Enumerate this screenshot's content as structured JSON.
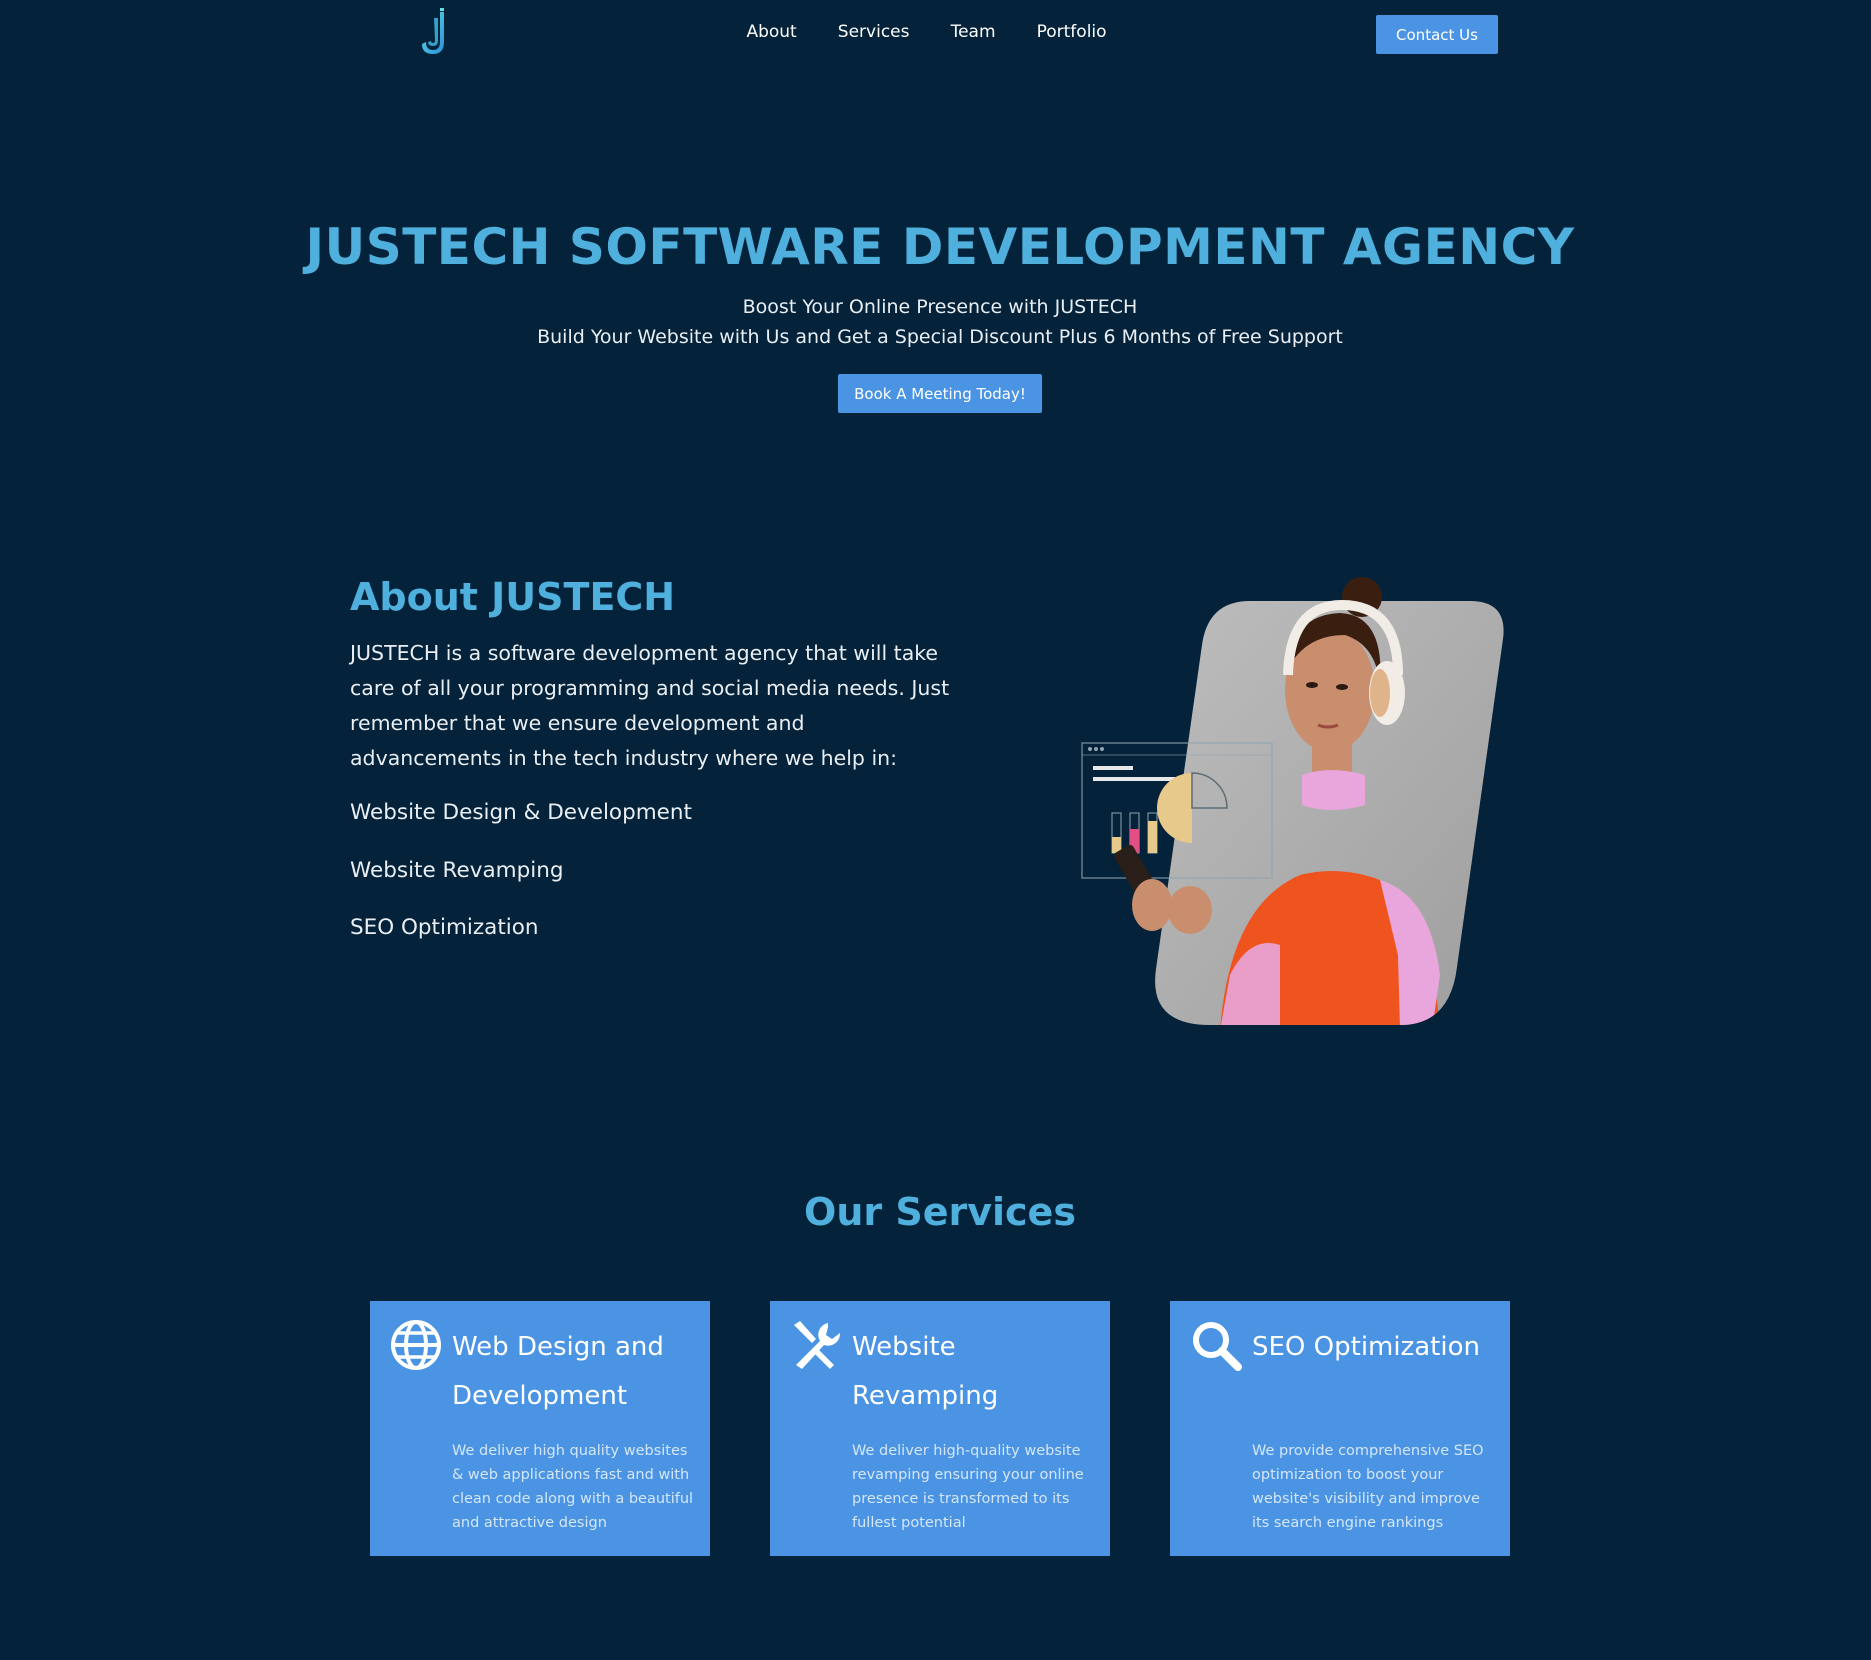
{
  "nav": {
    "logo_label": "J",
    "links": [
      "About",
      "Services",
      "Team",
      "Portfolio"
    ],
    "contact_label": "Contact Us"
  },
  "hero": {
    "title": "JUSTECH SOFTWARE DEVELOPMENT AGENCY",
    "subtitle1": "Boost Your Online Presence with JUSTECH",
    "subtitle2": "Build Your Website with Us and Get a Special Discount Plus 6 Months of Free Support",
    "cta_label": "Book A Meeting Today!"
  },
  "about": {
    "title": "About JUSTECH",
    "text": "JUSTECH is a software development agency that will take care of all your programming and social media needs. Just remember that we ensure development and advancements in the tech industry where we help in:",
    "items": [
      "Website Design & Development",
      "Website Revamping",
      "SEO Optimization"
    ]
  },
  "services": {
    "title": "Our Services",
    "cards": [
      {
        "icon": "globe-icon",
        "title": "Web Design and Development",
        "description": "We deliver high quality websites & web applications fast and with clean code along with a beautiful and attractive design"
      },
      {
        "icon": "tools-icon",
        "title": "Website Revamping",
        "description": "We deliver high-quality website revamping ensuring your online presence is transformed to its fullest potential"
      },
      {
        "icon": "search-icon",
        "title": "SEO Optimization",
        "description": "We provide comprehensive SEO optimization to boost your website's visibility and improve its search engine rankings"
      }
    ]
  },
  "colors": {
    "background": "#04233a",
    "accent": "#4fb0de",
    "button": "#4a94e3",
    "text": "#e9eef3"
  }
}
